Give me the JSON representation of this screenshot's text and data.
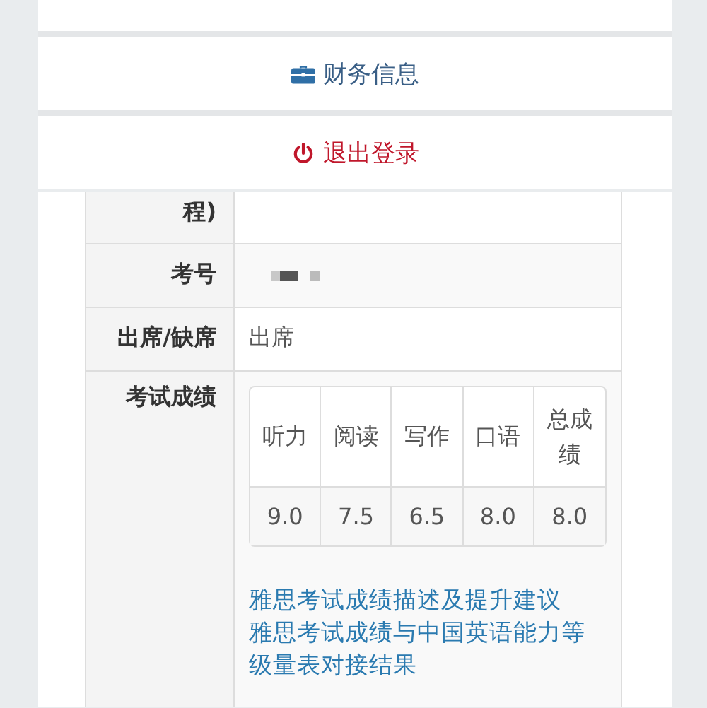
{
  "menu": {
    "items": [
      {
        "kind": "cut"
      },
      {
        "kind": "finance",
        "label": "财务信息"
      },
      {
        "kind": "logout",
        "label": "退出登录"
      }
    ]
  },
  "details": {
    "rows": [
      {
        "kind": "text",
        "label": "程)"
      },
      {
        "kind": "redacted",
        "label": "考号"
      },
      {
        "kind": "text",
        "label": "出席/缺席",
        "value": "出席"
      },
      {
        "kind": "scores",
        "label": "考试成绩"
      }
    ]
  },
  "scores": {
    "columns": [
      "听力",
      "阅读",
      "写作",
      "口语",
      "总成绩"
    ],
    "values": [
      "9.0",
      "7.5",
      "6.5",
      "8.0",
      "8.0"
    ]
  },
  "links": [
    "雅思考试成绩描述及提升建议",
    "雅思考试成绩与中国英语能力等级量表对接结果"
  ]
}
